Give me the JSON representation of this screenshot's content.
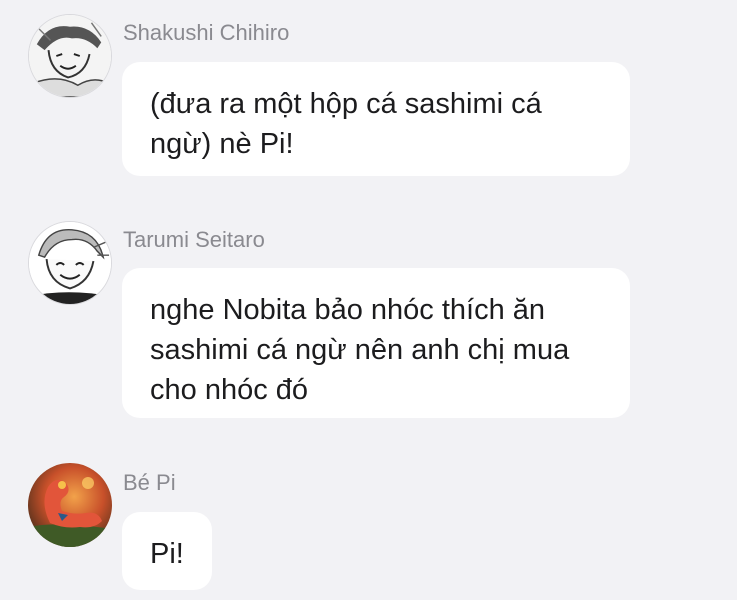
{
  "messages": [
    {
      "sender": "Shakushi Chihiro",
      "avatar_icon": "manga-boy-avatar",
      "text": "(đưa ra một hộp cá sashimi cá ngừ) nè Pi!"
    },
    {
      "sender": "Tarumi Seitaro",
      "avatar_icon": "manga-smiling-man-avatar",
      "text": "nghe Nobita bảo nhóc thích ăn sashimi cá ngừ nên anh chị mua cho nhóc đó"
    },
    {
      "sender": "Bé Pi",
      "avatar_icon": "flamingo-avatar",
      "text": "Pi!"
    }
  ],
  "colors": {
    "background": "#f2f2f5",
    "bubble": "#ffffff",
    "sender_name": "#8a8a90",
    "message_text": "#1c1c1e"
  }
}
